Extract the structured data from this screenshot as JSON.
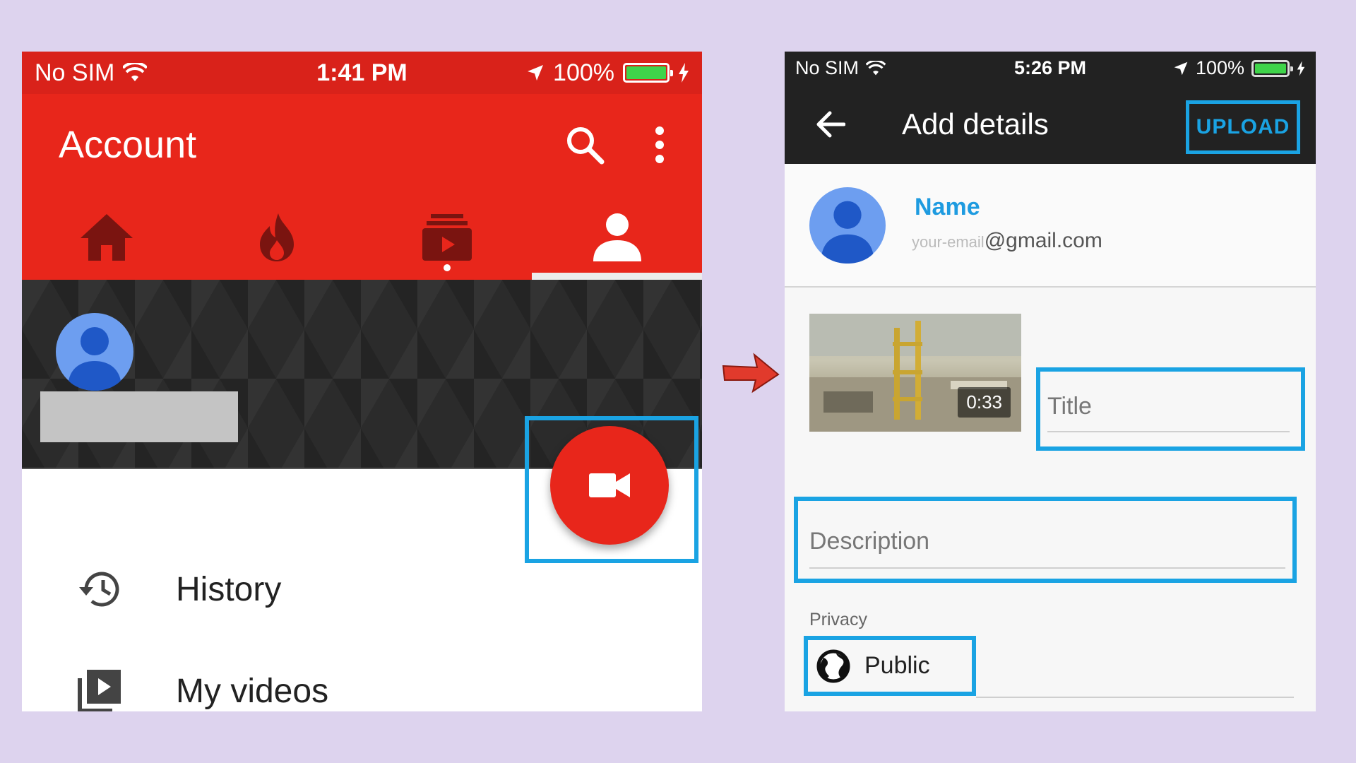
{
  "left_screen": {
    "status_bar": {
      "carrier": "No SIM",
      "time": "1:41 PM",
      "battery": "100%"
    },
    "app_bar": {
      "title": "Account",
      "search_icon": "search-icon",
      "more_icon": "more-vert-icon"
    },
    "tabs": [
      {
        "icon": "home-icon"
      },
      {
        "icon": "trending-flame-icon"
      },
      {
        "icon": "subscriptions-icon"
      },
      {
        "icon": "account-icon",
        "active": true
      }
    ],
    "fab_icon": "videocam-icon",
    "menu": [
      {
        "label": "History",
        "icon": "history-icon"
      },
      {
        "label": "My videos",
        "icon": "my-videos-icon"
      }
    ]
  },
  "right_screen": {
    "status_bar": {
      "carrier": "No SIM",
      "time": "5:26 PM",
      "battery": "100%"
    },
    "app_bar": {
      "title": "Add details",
      "upload_label": "UPLOAD"
    },
    "account": {
      "name": "Name",
      "email_local": "your-email",
      "email_domain": "@gmail.com"
    },
    "video": {
      "duration": "0:33"
    },
    "form": {
      "title_placeholder": "Title",
      "description_placeholder": "Description",
      "privacy_label": "Privacy",
      "privacy_value": "Public"
    }
  },
  "colors": {
    "brand_red": "#e8261b",
    "highlight_blue": "#1aa3e3",
    "dark_bar": "#222222",
    "page_bg": "#ddd3ee"
  }
}
